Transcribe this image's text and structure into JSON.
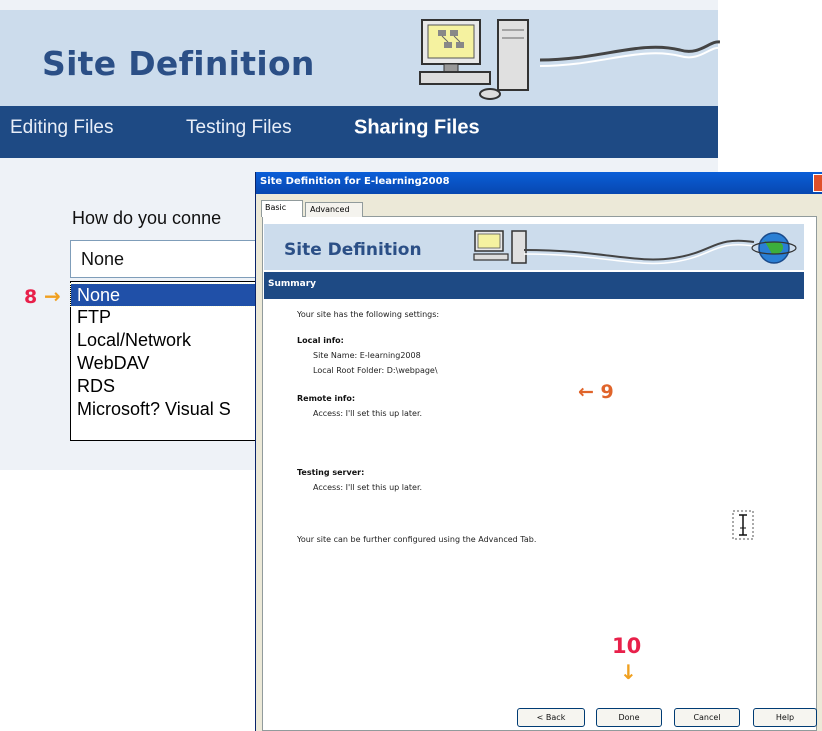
{
  "background_wizard": {
    "title": "Site Definition",
    "nav": {
      "editing": "Editing Files",
      "testing": "Testing Files",
      "sharing": "Sharing Files"
    },
    "question": "How do you conne",
    "select_value": "None",
    "options": [
      "None",
      "FTP",
      "Local/Network",
      "WebDAV",
      "RDS",
      "Microsoft? Visual S"
    ],
    "selected_option_index": 0
  },
  "annotations": {
    "step8": "8",
    "step9": "9",
    "step10": "10",
    "arrow_right": "→",
    "arrow_left": "←",
    "arrow_down": "↓"
  },
  "dialog": {
    "title": "Site Definition for E-learning2008",
    "tabs": [
      "Basic",
      "Advanced"
    ],
    "header_title": "Site Definition",
    "section_label": "Summary",
    "intro": "Your site has the following settings:",
    "local_info_label": "Local info:",
    "site_name": "Site Name: E-learning2008",
    "local_root": "Local Root Folder: D:\\webpage\\",
    "remote_info_label": "Remote info:",
    "remote_access": "Access: I'll set this up later.",
    "testing_server_label": "Testing server:",
    "testing_access": "Access: I'll set this up later.",
    "footer_note": "Your site can be further configured using the Advanced Tab.",
    "buttons": {
      "back": "< Back",
      "done": "Done",
      "cancel": "Cancel",
      "help": "Help"
    }
  },
  "colors": {
    "header_bg": "#ccdcec",
    "nav_bg": "#1e4a84",
    "title_blue": "#2b4f86",
    "selected_option": "#2050a8",
    "annotation_red": "#e8204a",
    "annotation_orange": "#f0a020"
  }
}
